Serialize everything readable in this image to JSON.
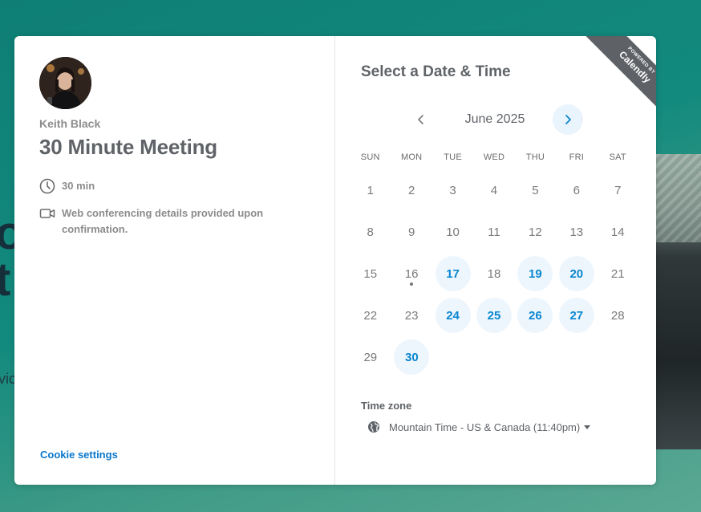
{
  "background": {
    "headline_fragment_1": "o",
    "headline_fragment_2": "t",
    "body_fragment": "vic"
  },
  "event": {
    "host_name": "Keith Black",
    "title": "30 Minute Meeting",
    "duration": "30 min",
    "location_note": "Web conferencing details provided upon confirmation."
  },
  "footer": {
    "cookie_settings": "Cookie settings"
  },
  "scheduler": {
    "title": "Select a Date & Time",
    "month_label": "June 2025",
    "weekdays": [
      "SUN",
      "MON",
      "TUE",
      "WED",
      "THU",
      "FRI",
      "SAT"
    ],
    "weeks": [
      [
        {
          "d": "1",
          "a": false
        },
        {
          "d": "2",
          "a": false
        },
        {
          "d": "3",
          "a": false
        },
        {
          "d": "4",
          "a": false
        },
        {
          "d": "5",
          "a": false
        },
        {
          "d": "6",
          "a": false
        },
        {
          "d": "7",
          "a": false
        }
      ],
      [
        {
          "d": "8",
          "a": false
        },
        {
          "d": "9",
          "a": false
        },
        {
          "d": "10",
          "a": false
        },
        {
          "d": "11",
          "a": false
        },
        {
          "d": "12",
          "a": false
        },
        {
          "d": "13",
          "a": false
        },
        {
          "d": "14",
          "a": false
        }
      ],
      [
        {
          "d": "15",
          "a": false
        },
        {
          "d": "16",
          "a": false,
          "today": true
        },
        {
          "d": "17",
          "a": true
        },
        {
          "d": "18",
          "a": false
        },
        {
          "d": "19",
          "a": true
        },
        {
          "d": "20",
          "a": true
        },
        {
          "d": "21",
          "a": false
        }
      ],
      [
        {
          "d": "22",
          "a": false
        },
        {
          "d": "23",
          "a": false
        },
        {
          "d": "24",
          "a": true
        },
        {
          "d": "25",
          "a": true
        },
        {
          "d": "26",
          "a": true
        },
        {
          "d": "27",
          "a": true
        },
        {
          "d": "28",
          "a": false
        }
      ],
      [
        {
          "d": "29",
          "a": false
        },
        {
          "d": "30",
          "a": true
        }
      ]
    ],
    "timezone_label": "Time zone",
    "timezone_value": "Mountain Time - US & Canada (11:40pm)"
  },
  "ribbon": {
    "powered_by": "POWERED BY",
    "brand": "Calendly"
  },
  "colors": {
    "accent": "#0a86d0",
    "available_bg": "#eef6fd",
    "ribbon_bg": "#5e6166",
    "page_bg": "#138a7e"
  }
}
